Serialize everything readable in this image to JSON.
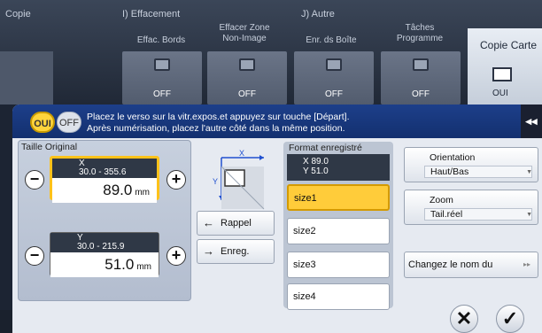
{
  "background": {
    "tab_headers": [
      "Copie",
      "I)  Effacement",
      "J)  Autre"
    ],
    "tiles": [
      {
        "title": "Effac. Bords",
        "value": "OFF"
      },
      {
        "title": "Effacer Zone Non-Image",
        "value": "OFF"
      },
      {
        "title": "Enr. ds Boîte",
        "value": "OFF"
      },
      {
        "title": "Tâches Programme",
        "value": "OFF"
      }
    ],
    "copie_carte": {
      "title": "Copie Carte",
      "value": "OUI"
    }
  },
  "dialog": {
    "toggle": {
      "on_label": "OUI",
      "off_label": "OFF",
      "selected": "OUI"
    },
    "message_line1": "Placez le verso sur la vitr.expos.et appuyez sur touche [Départ].",
    "message_line2": "Après numérisation, placez l'autre côté dans la même position.",
    "collapse_glyph": "◂◂",
    "size_panel": {
      "title": "Taille Original",
      "x": {
        "axis": "X",
        "range": "30.0 - 355.6",
        "value": "89.0",
        "unit": "mm",
        "badge": "X"
      },
      "y": {
        "axis": "Y",
        "range": "30.0 - 215.9",
        "value": "51.0",
        "unit": "mm",
        "badge": "Y"
      },
      "minus": "−",
      "plus": "+"
    },
    "diagram": {
      "x_label": "X",
      "y_label": "Y"
    },
    "rappel_label": "Rappel",
    "enreg_label": "Enreg.",
    "format": {
      "title": "Format enregistré",
      "x_line": "X  89.0",
      "y_line": "Y  51.0",
      "sizes": [
        "size1",
        "size2",
        "size3",
        "size4"
      ],
      "selected": "size1"
    },
    "orientation": {
      "label": "Orientation",
      "value": "Haut/Bas"
    },
    "zoom": {
      "label": "Zoom",
      "value": "Tail.réel"
    },
    "rename_label": "Changez le nom du",
    "cancel_glyph": "✕",
    "ok_glyph": "✓"
  }
}
